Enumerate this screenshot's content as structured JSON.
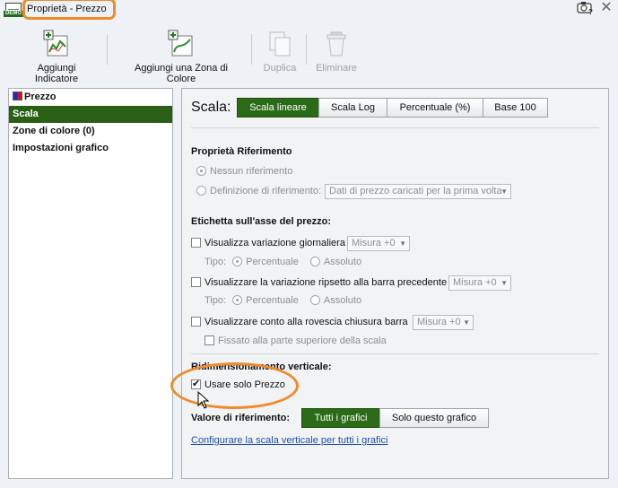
{
  "window": {
    "title": "Proprietà - Prezzo",
    "app_badge": "DEMO"
  },
  "toolbar": {
    "add_indicator": "Aggiungi Indicatore",
    "add_color_zone": "Aggiungi una Zona di Colore",
    "duplicate": "Duplica",
    "delete": "Eliminare"
  },
  "sidebar": {
    "items": [
      {
        "label": "Prezzo"
      },
      {
        "label": "Scala"
      },
      {
        "label": "Zone di colore (0)"
      },
      {
        "label": "Impostazioni grafico"
      }
    ]
  },
  "scale": {
    "label": "Scala:",
    "options": [
      "Scala lineare",
      "Scala Log",
      "Percentuale (%)",
      "Base 100"
    ],
    "selected": "Scala lineare"
  },
  "reference": {
    "heading": "Proprietà Riferimento",
    "none": "Nessun riferimento",
    "definition": "Definizione di riferimento:",
    "definition_value": "Dati di prezzo caricati per la prima volta"
  },
  "price_axis": {
    "heading": "Etichetta sull'asse del prezzo:",
    "daily_change": "Visualizza variazione giornaliera",
    "daily_change_measure": "Misura +0",
    "type_label": "Tipo:",
    "percent": "Percentuale",
    "absolute": "Assoluto",
    "prev_bar_change": "Visualizzare la variazione ripsetto alla barra precedente",
    "prev_bar_measure": "Misura +0",
    "type_label_2": "Tipo:",
    "percent_2": "Percentuale",
    "absolute_2": "Assoluto",
    "countdown": "Visualizzare conto alla rovescia chiusura barra",
    "countdown_measure": "Misura +0",
    "fixed_top": "Fissato alla parte superiore della scala"
  },
  "vertical": {
    "heading": "Ridimensionamento verticale:",
    "use_price_only": "Usare solo Prezzo",
    "use_price_only_checked": true,
    "ref_value_label": "Valore di riferimento:",
    "all_charts": "Tutti i grafici",
    "this_chart": "Solo questo grafico",
    "link": "Configurare la scala verticale per tutti i grafici"
  },
  "colors": {
    "accent_green": "#2b6a17",
    "highlight_orange": "#f08a2c",
    "link_blue": "#1f4fb0"
  }
}
